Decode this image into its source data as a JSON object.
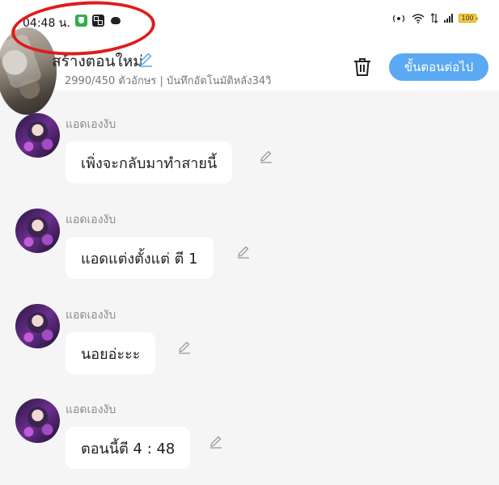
{
  "status_bar": {
    "time": "04:48 น.",
    "battery": "100",
    "icons": [
      "shield-app-icon",
      "qr-app-icon",
      "discord-icon",
      "hotspot-icon",
      "wifi-icon",
      "data-icon",
      "signal-icon",
      "battery-icon"
    ]
  },
  "header": {
    "title": "สร้างตอนใหม่",
    "subtitle": "2990/450 ตัวอักษร | บันทึกอัตโนมัติหลัง34วิ",
    "next_label": "ขั้นตอนต่อไป",
    "accent": "#5aa9f2",
    "annotation_color": "#e01b1b"
  },
  "messages": [
    {
      "sender": "แอดเองงับ",
      "text": "เพิ่งจะกลับมาทำสายนี้"
    },
    {
      "sender": "แอดเองงับ",
      "text": "แอดแต่งตั้งแต่ ตี 1"
    },
    {
      "sender": "แอดเองงับ",
      "text": "นอยอ่ะะะ"
    },
    {
      "sender": "แอดเองงับ",
      "text": "ตอนนี้ตี 4 : 48"
    }
  ]
}
